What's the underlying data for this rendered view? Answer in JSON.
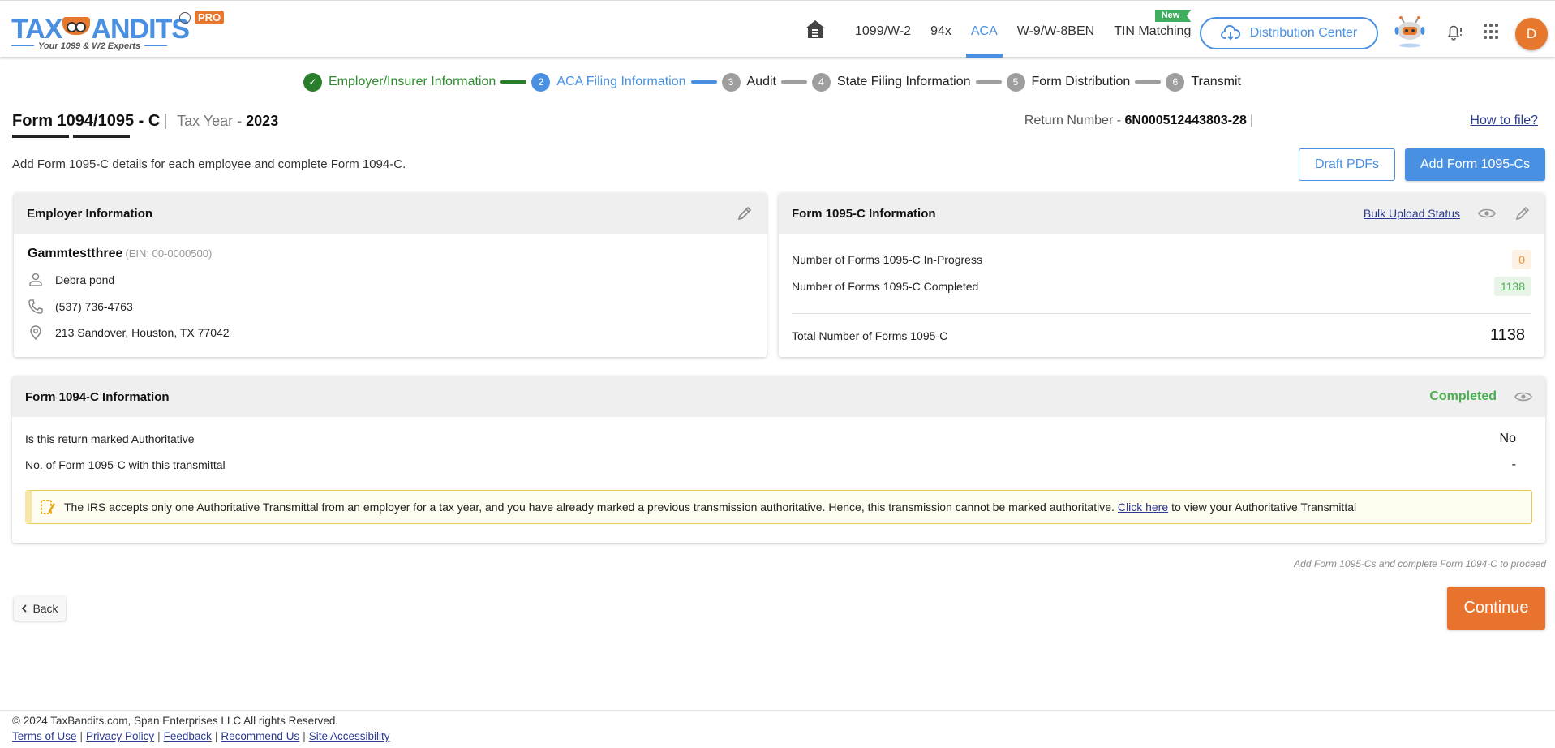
{
  "brand": {
    "name_left": "TAX",
    "name_right": "ANDITS",
    "tm": "TM",
    "pro_badge": "PRO",
    "tagline": "Your 1099 & W2 Experts"
  },
  "nav": {
    "home_icon": "home-icon",
    "items": [
      {
        "label": "1099/W-2",
        "active": false
      },
      {
        "label": "94x",
        "active": false
      },
      {
        "label": "ACA",
        "active": true
      },
      {
        "label": "W-9/W-8BEN",
        "active": false
      },
      {
        "label": "TIN Matching",
        "active": false,
        "badge": "New"
      }
    ],
    "distribution_center": "Distribution Center",
    "avatar_initial": "D"
  },
  "stepper": {
    "steps": [
      {
        "num": "✓",
        "label": "Employer/Insurer Information",
        "state": "done"
      },
      {
        "num": "2",
        "label": "ACA Filing Information",
        "state": "current"
      },
      {
        "num": "3",
        "label": "Audit",
        "state": "pending"
      },
      {
        "num": "4",
        "label": "State Filing Information",
        "state": "pending"
      },
      {
        "num": "5",
        "label": "Form Distribution",
        "state": "pending"
      },
      {
        "num": "6",
        "label": "Transmit",
        "state": "pending"
      }
    ]
  },
  "header": {
    "form_title": "Form 1094/1095 - C",
    "tax_year_label": "Tax Year - ",
    "tax_year": "2023",
    "return_number_label": "Return Number - ",
    "return_number": "6N000512443803-28",
    "how_to_file": "How to file?",
    "subtitle": "Add Form 1095-C details for each employee and complete Form 1094-C.",
    "draft_pdfs": "Draft PDFs",
    "add_forms": "Add Form 1095-Cs"
  },
  "employer": {
    "title": "Employer Information",
    "name": "Gammtestthree",
    "ein": "(EIN: 00-0000500)",
    "contact": "Debra pond",
    "phone": "(537) 736-4763",
    "address": "213 Sandover, Houston, TX 77042"
  },
  "form1095c": {
    "title": "Form 1095-C Information",
    "bulk_upload_status": "Bulk Upload Status",
    "in_progress_label": "Number of Forms 1095-C In-Progress",
    "in_progress_value": "0",
    "completed_label": "Number of Forms 1095-C Completed",
    "completed_value": "1138",
    "total_label": "Total Number of Forms 1095-C",
    "total_value": "1138"
  },
  "form1094c": {
    "title": "Form 1094-C Information",
    "status": "Completed",
    "authoritative_label": "Is this return marked Authoritative",
    "authoritative_value": "No",
    "count_label": "No. of Form 1095-C with this transmittal",
    "count_value": "-",
    "alert_text_before": "The IRS accepts only one Authoritative Transmittal from an employer for a tax year, and you have already marked a previous transmission authoritative. Hence, this transmission cannot be marked authoritative. ",
    "alert_link": "Click here",
    "alert_text_after": " to view your Authoritative Transmittal"
  },
  "actions": {
    "proceed_note": "Add Form 1095-Cs and complete Form 1094-C to proceed",
    "back": "Back",
    "continue": "Continue"
  },
  "footer": {
    "copyright": "© 2024 TaxBandits.com, Span Enterprises LLC All rights Reserved.",
    "links": [
      "Terms of Use",
      "Privacy Policy",
      "Feedback",
      "Recommend Us",
      "Site Accessibility"
    ]
  },
  "colors": {
    "primary": "#4a90e2",
    "accent_orange": "#e8732e",
    "success": "#4caf50",
    "step_done": "#2a7d2a"
  }
}
